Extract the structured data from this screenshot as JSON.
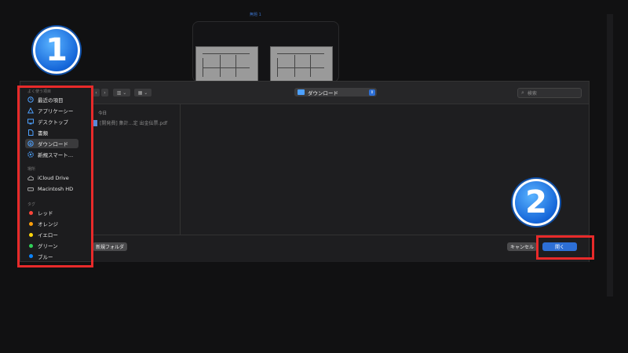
{
  "background": {
    "title": "無題 1"
  },
  "badges": [
    "1",
    "2"
  ],
  "sidebar": {
    "sections": {
      "favorites": "よく使う項目",
      "locations": "場所",
      "tags": "タグ"
    },
    "favorites": [
      {
        "label": "最近の項目",
        "icon": "clock-icon"
      },
      {
        "label": "アプリケーシー",
        "icon": "apps-icon"
      },
      {
        "label": "デスクトップ",
        "icon": "desktop-icon"
      },
      {
        "label": "書類",
        "icon": "document-icon"
      },
      {
        "label": "ダウンロード",
        "icon": "download-icon",
        "selected": true
      },
      {
        "label": "新規スマート…",
        "icon": "gear-icon"
      }
    ],
    "locations": [
      {
        "label": "iCloud Drive",
        "icon": "cloud-icon"
      },
      {
        "label": "Macintosh HD",
        "icon": "disk-icon"
      }
    ],
    "tags": [
      {
        "label": "レッド",
        "color": "#ff453a"
      },
      {
        "label": "オレンジ",
        "color": "#ff9f0a"
      },
      {
        "label": "イエロー",
        "color": "#ffd60a"
      },
      {
        "label": "グリーン",
        "color": "#30d158"
      },
      {
        "label": "ブルー",
        "color": "#0a84ff"
      }
    ]
  },
  "toolbar": {
    "location": "ダウンロード",
    "search_placeholder": "検索"
  },
  "files": {
    "group": "今日",
    "items": [
      "[開発費] 集計…定 出金伝票.pdf"
    ]
  },
  "footer": {
    "new_folder": "新規フォルダ",
    "cancel": "キャンセル",
    "open": "開く"
  },
  "colors": {
    "accent": "#2d6fd6",
    "highlight": "#e82a2a",
    "badge": "#1566d9"
  }
}
